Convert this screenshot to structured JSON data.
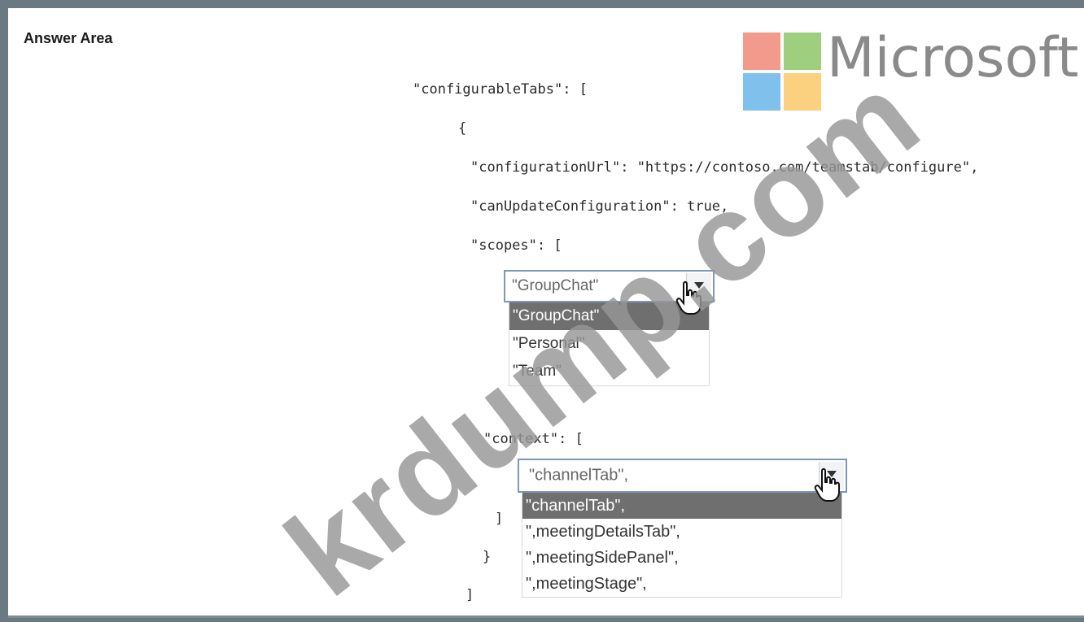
{
  "header": {
    "title": "Answer Area"
  },
  "logo": {
    "text": "Microsoft",
    "colors": [
      "#f29b8c",
      "#9dcf7e",
      "#7fc0ec",
      "#fbd180"
    ]
  },
  "watermark": {
    "text": "krdump.com"
  },
  "code": {
    "l1": "\"configurableTabs\": [",
    "l2": "{",
    "l3": "\"configurationUrl\": \"https://contoso.com/teamstab/configure\",",
    "l4": "\"canUpdateConfiguration\": true,",
    "l5": "\"scopes\": [",
    "l6": "\"context\": [",
    "l7": "]",
    "l8": "}",
    "l9": "]"
  },
  "scopes_dropdown": {
    "selected": "\"GroupChat\"",
    "options": [
      "\"GroupChat\"",
      "\"Personal\"",
      "\"Team\""
    ]
  },
  "context_dropdown": {
    "selected": "\"channelTab\",",
    "options": [
      "\"channelTab\",",
      "\",meetingDetailsTab\",",
      "\",meetingSidePanel\",",
      "\",meetingStage\","
    ]
  }
}
